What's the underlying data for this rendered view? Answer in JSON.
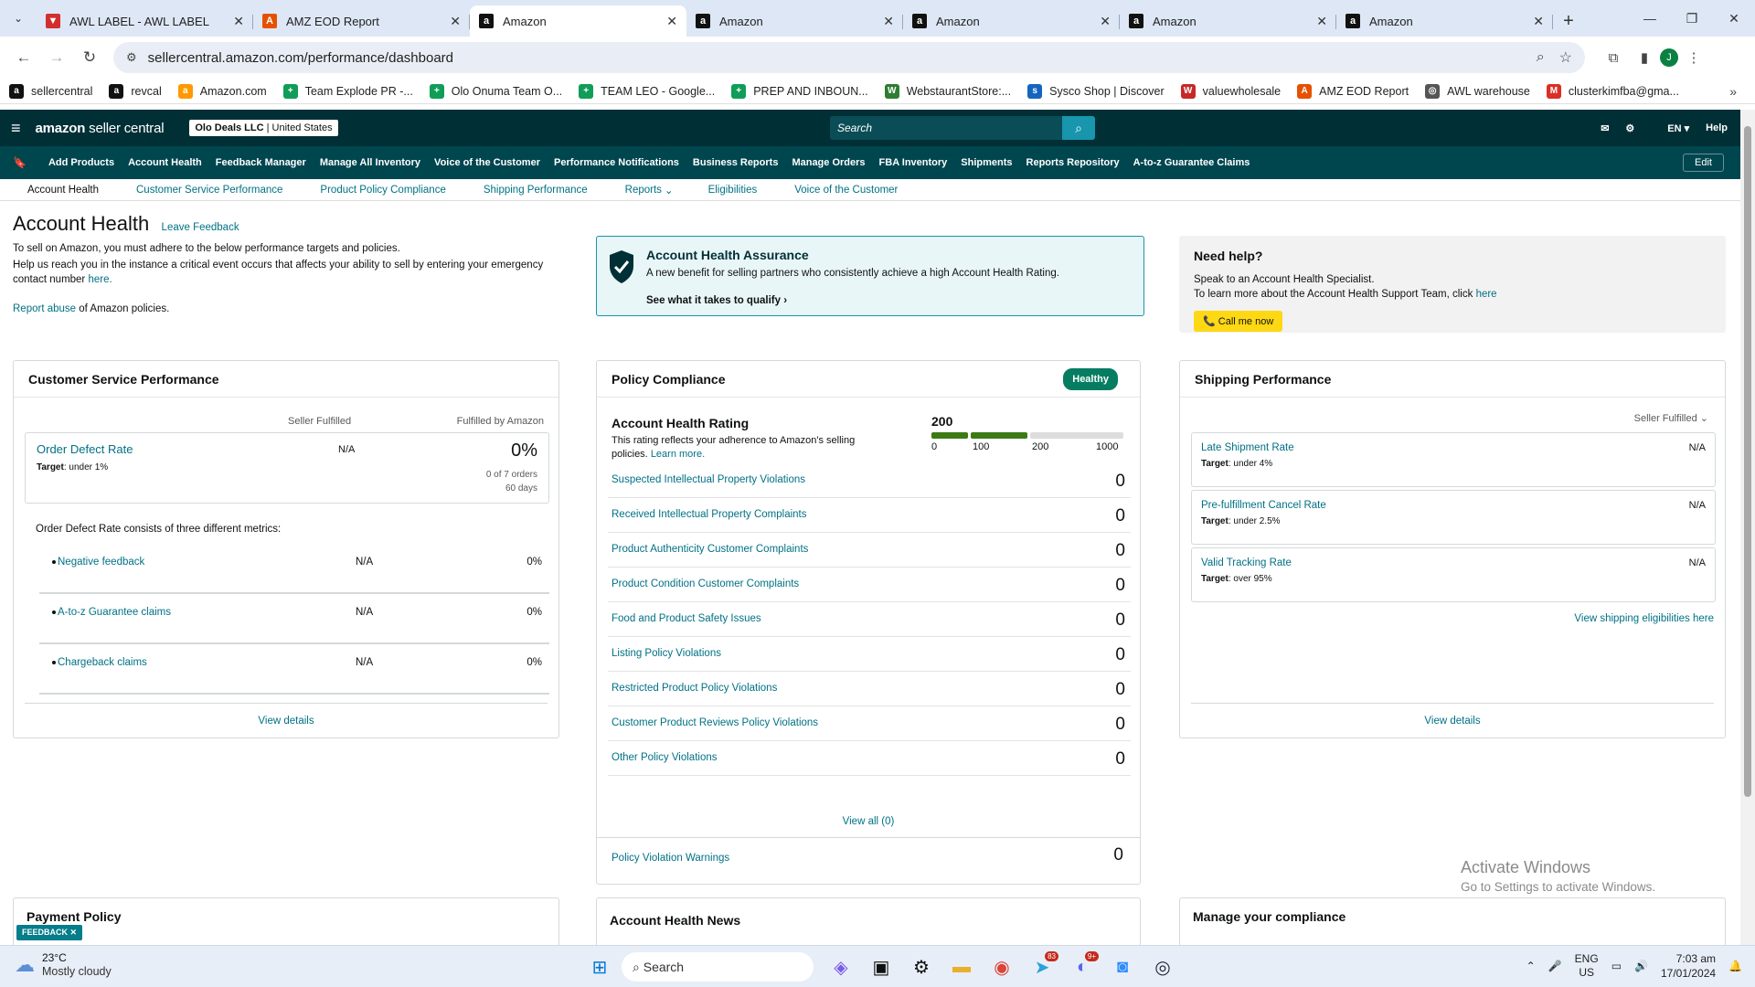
{
  "browser": {
    "tabs": [
      {
        "title": "AWL LABEL - AWL LABEL",
        "icon": "awl-label-icon",
        "active": false
      },
      {
        "title": "AMZ EOD Report",
        "icon": "amz-eod-icon",
        "active": false
      },
      {
        "title": "Amazon",
        "icon": "amazon-icon",
        "active": true
      },
      {
        "title": "Amazon",
        "icon": "amazon-icon",
        "active": false
      },
      {
        "title": "Amazon",
        "icon": "amazon-icon",
        "active": false
      },
      {
        "title": "Amazon",
        "icon": "amazon-icon",
        "active": false
      },
      {
        "title": "Amazon",
        "icon": "amazon-icon",
        "active": false
      }
    ],
    "url": "sellercentral.amazon.com/performance/dashboard",
    "profile_initial": "J",
    "bookmarks": [
      {
        "label": "sellercentral",
        "color": "#111111",
        "glyph": "a"
      },
      {
        "label": "revcal",
        "color": "#111111",
        "glyph": "a"
      },
      {
        "label": "Amazon.com",
        "color": "#ff9900",
        "glyph": "a"
      },
      {
        "label": "Team Explode PR -...",
        "color": "#0f9d58",
        "glyph": "+"
      },
      {
        "label": "Olo Onuma Team O...",
        "color": "#0f9d58",
        "glyph": "+"
      },
      {
        "label": "TEAM LEO - Google...",
        "color": "#0f9d58",
        "glyph": "+"
      },
      {
        "label": "PREP AND INBOUN...",
        "color": "#0f9d58",
        "glyph": "+"
      },
      {
        "label": "WebstaurantStore:...",
        "color": "#2e7d32",
        "glyph": "W"
      },
      {
        "label": "Sysco Shop | Discover",
        "color": "#1565c0",
        "glyph": "s"
      },
      {
        "label": "valuewholesale",
        "color": "#c62828",
        "glyph": "W"
      },
      {
        "label": "AMZ EOD Report",
        "color": "#e65100",
        "glyph": "A"
      },
      {
        "label": "AWL warehouse",
        "color": "#555555",
        "glyph": "◎"
      },
      {
        "label": "clusterkimfba@gma...",
        "color": "#d93025",
        "glyph": "M"
      }
    ]
  },
  "sc": {
    "logo_a": "amazon",
    "logo_b": " seller central",
    "store_name": "Olo Deals LLC",
    "store_region": "United States",
    "search_placeholder": "Search",
    "lang": "EN",
    "help": "Help",
    "nav": [
      "Add Products",
      "Account Health",
      "Feedback Manager",
      "Manage All Inventory",
      "Voice of the Customer",
      "Performance Notifications",
      "Business Reports",
      "Manage Orders",
      "FBA Inventory",
      "Shipments",
      "Reports Repository",
      "A-to-z Guarantee Claims"
    ],
    "edit": "Edit",
    "subnav": [
      "Account Health",
      "Customer Service Performance",
      "Product Policy Compliance",
      "Shipping Performance",
      "Reports",
      "Eligibilities",
      "Voice of the Customer"
    ]
  },
  "page": {
    "title": "Account Health",
    "leave_feedback": "Leave Feedback",
    "intro1": "To sell on Amazon, you must adhere to the below performance targets and policies.",
    "intro2": "Help us reach you in the instance a critical event occurs that affects your ability to sell by entering your emergency contact number",
    "intro2_link": "here.",
    "report_abuse": "Report abuse",
    "report_abuse_tail": " of Amazon policies."
  },
  "aha": {
    "title": "Account Health Assurance",
    "desc": "A new benefit for selling partners who consistently achieve a high Account Health Rating.",
    "cta": "See what it takes to qualify"
  },
  "help": {
    "title": "Need help?",
    "line1": "Speak to an Account Health Specialist.",
    "line2": "To learn more about the Account Health Support Team, click",
    "line2_link": "here",
    "call": "Call me now"
  },
  "csp": {
    "title": "Customer Service Performance",
    "col1": "Seller Fulfilled",
    "col2": "Fulfilled by Amazon",
    "odr_name": "Order Defect Rate",
    "odr_target_label": "Target",
    "odr_target": ": under 1%",
    "odr_sf": "N/A",
    "odr_fba": "0%",
    "odr_orders": "0 of 7 orders",
    "odr_days": "60 days",
    "desc": "Order Defect Rate consists of three different metrics:",
    "metrics": [
      {
        "name": "Negative feedback",
        "sf": "N/A",
        "fba": "0%"
      },
      {
        "name": "A-to-z Guarantee claims",
        "sf": "N/A",
        "fba": "0%"
      },
      {
        "name": "Chargeback claims",
        "sf": "N/A",
        "fba": "0%"
      }
    ],
    "view_details": "View details"
  },
  "pc": {
    "title": "Policy Compliance",
    "status": "Healthy",
    "ahr_title": "Account Health Rating",
    "ahr_desc": "This rating reflects your adherence to Amazon's selling policies.",
    "ahr_link": "Learn more.",
    "rating": "200",
    "scale": [
      "0",
      "100",
      "200",
      "1000"
    ],
    "violations": [
      {
        "label": "Suspected Intellectual Property Violations",
        "count": "0"
      },
      {
        "label": "Received Intellectual Property Complaints",
        "count": "0"
      },
      {
        "label": "Product Authenticity Customer Complaints",
        "count": "0"
      },
      {
        "label": "Product Condition Customer Complaints",
        "count": "0"
      },
      {
        "label": "Food and Product Safety Issues",
        "count": "0"
      },
      {
        "label": "Listing Policy Violations",
        "count": "0"
      },
      {
        "label": "Restricted Product Policy Violations",
        "count": "0"
      },
      {
        "label": "Customer Product Reviews Policy Violations",
        "count": "0"
      },
      {
        "label": "Other Policy Violations",
        "count": "0"
      }
    ],
    "view_all": "View all (0)",
    "warnings_label": "Policy Violation Warnings",
    "warnings_count": "0"
  },
  "sp": {
    "title": "Shipping Performance",
    "filter": "Seller Fulfilled",
    "rows": [
      {
        "name": "Late Shipment Rate",
        "target": ": under 4%",
        "value": "N/A"
      },
      {
        "name": "Pre-fulfillment Cancel Rate",
        "target": ": under 2.5%",
        "value": "N/A"
      },
      {
        "name": "Valid Tracking Rate",
        "target": ": over 95%",
        "value": "N/A"
      }
    ],
    "target_label": "Target",
    "eligibilities": "View shipping eligibilities here",
    "view_details": "View details"
  },
  "bottom": {
    "payment": "Payment Policy",
    "news": "Account Health News",
    "compliance": "Manage your compliance"
  },
  "overlay": {
    "feedback": "FEEDBACK",
    "activate1": "Activate Windows",
    "activate2": "Go to Settings to activate Windows."
  },
  "taskbar": {
    "temp": "23°C",
    "weather": "Mostly cloudy",
    "search": "Search",
    "badge_telegram": "83",
    "badge_discord": "9+",
    "lang1": "ENG",
    "lang2": "US",
    "time": "7:03 am",
    "date": "17/01/2024"
  }
}
